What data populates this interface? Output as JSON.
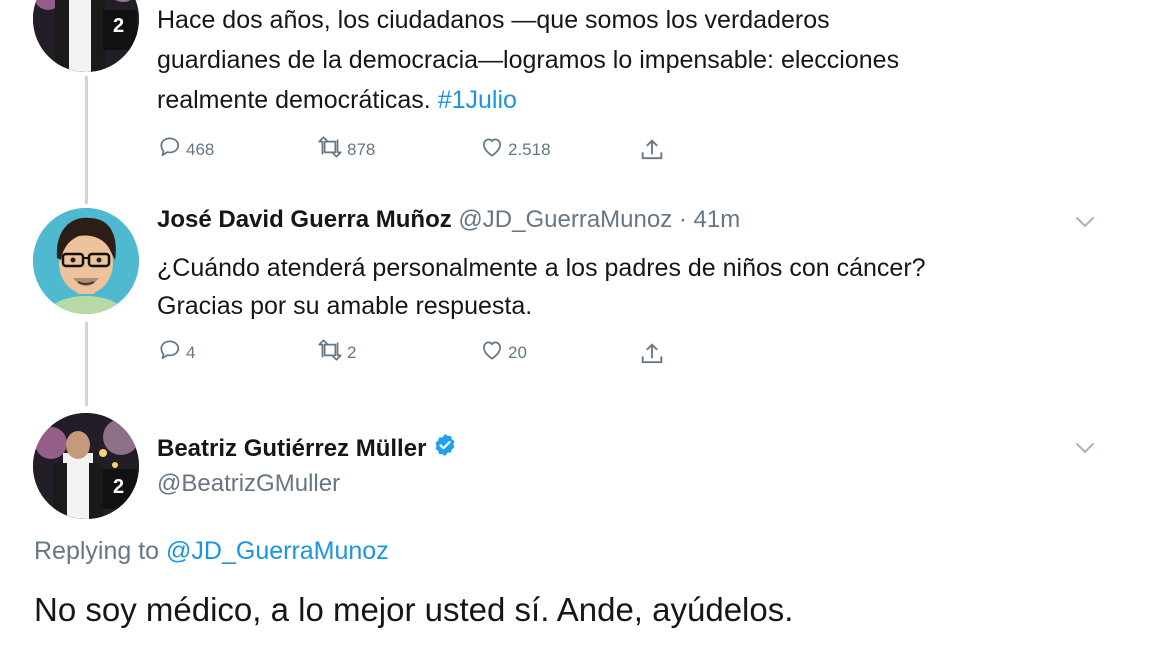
{
  "tweet1": {
    "text_line1": "Hace dos años, los ciudadanos —que somos los verdaderos",
    "text_line2": "guardianes de la democracia—logramos lo impensable: elecciones",
    "text_line3_prefix": "realmente democráticas. ",
    "hashtag": "#1Julio",
    "reply_count": "468",
    "retweet_count": "878",
    "like_count": "2.518"
  },
  "tweet2": {
    "display_name": "José David Guerra Muñoz",
    "handle_time": "@JD_GuerraMunoz · 41m",
    "text_line1": "¿Cuándo atenderá personalmente a los padres de niños con cáncer?",
    "text_line2": "Gracias por su amable respuesta.",
    "reply_count": "4",
    "retweet_count": "2",
    "like_count": "20"
  },
  "tweet3": {
    "display_name": "Beatriz Gutiérrez Müller",
    "handle": "@BeatrizGMuller",
    "replying_label": "Replying to ",
    "replying_mention": "@JD_GuerraMunoz",
    "text": "No soy médico, a lo mejor usted sí. Ande, ayúdelos."
  },
  "avatar_badge": "2",
  "colors": {
    "link": "#1b95e0",
    "secondary": "#657786",
    "primary_text": "#14171a",
    "verified": "#1da1f2",
    "thread_line": "#ccd6dd"
  },
  "icons": [
    "reply-icon",
    "retweet-icon",
    "like-icon",
    "share-icon",
    "chevron-down-icon",
    "verified-badge-icon"
  ]
}
